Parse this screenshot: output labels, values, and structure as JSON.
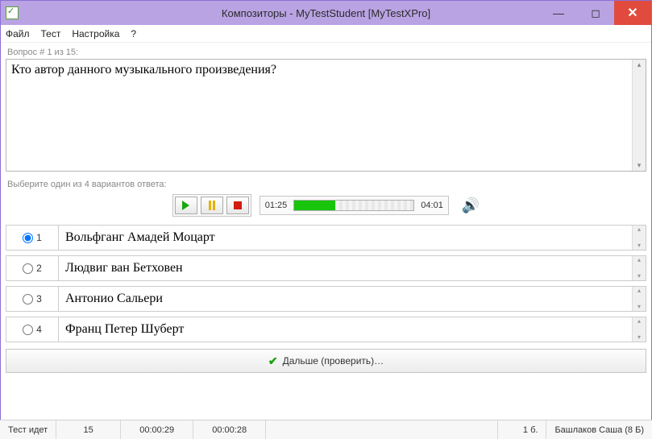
{
  "window": {
    "title": "Композиторы - MyTestStudent [MyTestXPro]"
  },
  "menu": {
    "file": "Файл",
    "test": "Тест",
    "settings": "Настройка",
    "help": "?"
  },
  "question": {
    "counter": "Вопрос # 1 из 15:",
    "text": "Кто автор данного музыкального произведения?",
    "hint": "Выберите один из 4 вариантов ответа:"
  },
  "player": {
    "current": "01:25",
    "total": "04:01"
  },
  "answers": [
    {
      "num": "1",
      "text": "Вольфганг Амадей Моцарт",
      "selected": true
    },
    {
      "num": "2",
      "text": "Людвиг ван Бетховен",
      "selected": false
    },
    {
      "num": "3",
      "text": "Антонио Сальери",
      "selected": false
    },
    {
      "num": "4",
      "text": "Франц Петер Шуберт",
      "selected": false
    }
  ],
  "next_button": "Дальше (проверить)…",
  "status": {
    "state": "Тест идет",
    "total_q": "15",
    "time1": "00:00:29",
    "time2": "00:00:28",
    "score": "1 б.",
    "user": "Башлаков Саша (8 Б)"
  }
}
